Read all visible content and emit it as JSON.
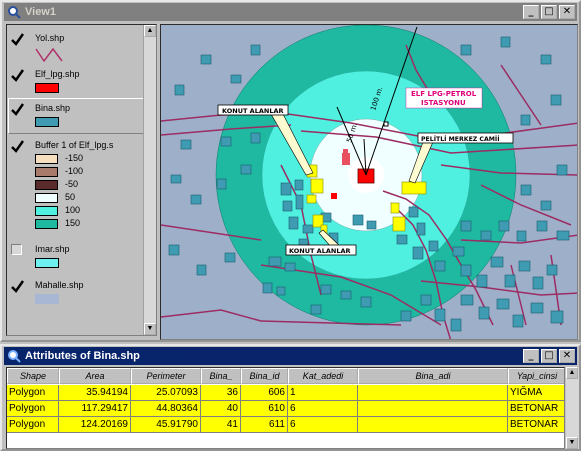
{
  "view_window": {
    "title": "View1",
    "buttons": {
      "minimize": "_",
      "maximize": "□",
      "close": "✕"
    }
  },
  "legend": {
    "layers": [
      {
        "name": "Yol.shp",
        "checked": true,
        "symbol": "line",
        "color": "#b0306a"
      },
      {
        "name": "Elf_lpg.shp",
        "checked": true,
        "symbol": "fill",
        "color": "#ff0000"
      },
      {
        "name": "Bina.shp",
        "checked": true,
        "symbol": "fill",
        "color": "#3f9bb2"
      },
      {
        "name": "Buffer 1 of Elf_lpg.s",
        "checked": true,
        "symbol": "classes"
      },
      {
        "name": "Imar.shp",
        "checked": false,
        "symbol": "fill",
        "color": "#6ff0f0"
      },
      {
        "name": "Mahalle.shp",
        "checked": true,
        "symbol": "fill",
        "color": "#a8b8d4"
      }
    ],
    "buffer_classes": [
      {
        "label": "-150",
        "color": "#f5dfbf"
      },
      {
        "label": "-100",
        "color": "#a87a6c"
      },
      {
        "label": "-50",
        "color": "#5a2b2b"
      },
      {
        "label": "50",
        "color": "#f0ffff"
      },
      {
        "label": "100",
        "color": "#4ff0e0"
      },
      {
        "label": "150",
        "color": "#1fb8a0"
      }
    ]
  },
  "map": {
    "labels": {
      "konut_top": "KONUT ALANLAR",
      "konut_bottom": "KONUT ALANLAR",
      "elf": "ELF LPG-PETROL\nISTASYONU",
      "pelitli": "PELİTLİ MERKEZ CAMİİ",
      "dist_100": "100 m.",
      "dist_50": "50 m."
    },
    "colors": {
      "background": "#9eb0c9",
      "ring150": "#1fb8a0",
      "ring100": "#4ff0e0",
      "ring50": "#f0ffff",
      "building": "#3f9bb2",
      "selected_building": "#ffff00",
      "station": "#ff0000",
      "road": "#9c2c63"
    }
  },
  "attributes_window": {
    "title": "Attributes of Bina.shp",
    "columns": [
      "Shape",
      "Area",
      "Perimeter",
      "Bina_",
      "Bina_id",
      "Kat_adedi",
      "Bina_adi",
      "Yapi_cinsi"
    ],
    "rows": [
      [
        "Polygon",
        "35.94194",
        "25.07093",
        "36",
        "606",
        "1",
        "",
        "YIĞMA"
      ],
      [
        "Polygon",
        "117.29417",
        "44.80364",
        "40",
        "610",
        "6",
        "",
        "BETONAR"
      ],
      [
        "Polygon",
        "124.20169",
        "45.91790",
        "41",
        "611",
        "6",
        "",
        "BETONAR"
      ]
    ]
  }
}
